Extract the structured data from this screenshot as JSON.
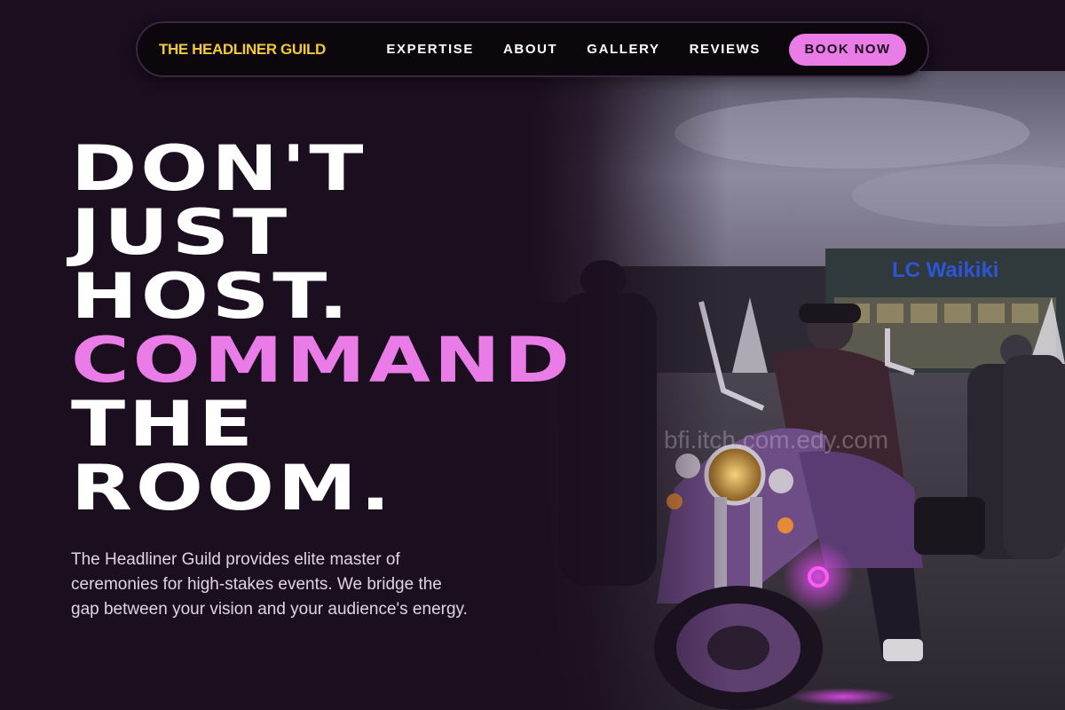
{
  "brand": {
    "name": "THE HEADLINER GUILD"
  },
  "nav": {
    "links": [
      "EXPERTISE",
      "ABOUT",
      "GALLERY",
      "REVIEWS"
    ],
    "cta_label": "BOOK NOW"
  },
  "hero": {
    "headline_lines": [
      "DON'T",
      "JUST",
      "HOST."
    ],
    "headline_accent": "COMMAND",
    "headline_tail": [
      "THE",
      "ROOM."
    ],
    "description": "The Headliner Guild provides elite master of ceremonies for high-stakes events. We bridge the gap between your vision and your audience's energy.",
    "photo": {
      "subject": "rider on motorcycle with purple underglow in front of a venue",
      "signage": "LC Waikiki",
      "watermark": "bfi.itch.com.edy.com"
    }
  },
  "colors": {
    "background": "#1b0e1f",
    "accent": "#ea7ce7",
    "brand": "#f2c93b",
    "nav_bg": "#0b070d"
  }
}
